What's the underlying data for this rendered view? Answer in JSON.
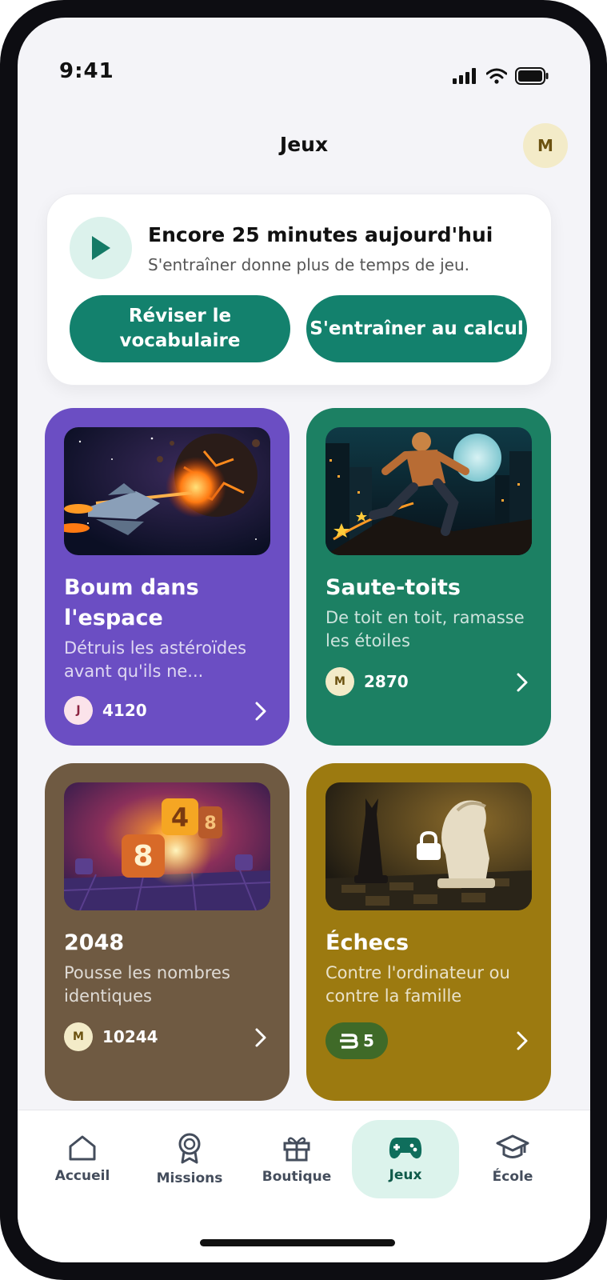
{
  "status": {
    "time": "9:41"
  },
  "header": {
    "title": "Jeux",
    "avatar_initial": "M"
  },
  "promo": {
    "title": "Encore 25 minutes aujourd'hui",
    "subtitle": "S'entraîner donne plus de temps de jeu.",
    "button_vocab": "Réviser le vocabulaire",
    "button_calc": "S'entraîner au calcul"
  },
  "games": [
    {
      "title": "Boum dans l'espace",
      "desc": "Détruis les astéroïdes avant qu'ils ne...",
      "player": "J",
      "score": "4120",
      "color": "#6b4ec3",
      "icon": "chevron-right-icon"
    },
    {
      "title": "Saute-toits",
      "desc": "De toit en toit, ramasse les étoiles",
      "player": "M",
      "score": "2870",
      "color": "#1c8063",
      "icon": "chevron-right-icon"
    },
    {
      "title": "2048",
      "desc": "Pousse les nombres identiques",
      "player": "M",
      "score": "10244",
      "color": "#6f5a42",
      "icon": "chevron-right-icon"
    },
    {
      "title": "Échecs",
      "desc": "Contre l'ordinateur ou contre la famille",
      "unlock_cost": "5",
      "color": "#9c7a10",
      "locked": true,
      "icon": "lock-icon"
    }
  ],
  "nav": {
    "items": [
      {
        "label": "Accueil",
        "icon": "home-icon"
      },
      {
        "label": "Missions",
        "icon": "medal-icon"
      },
      {
        "label": "Boutique",
        "icon": "gift-icon"
      },
      {
        "label": "Jeux",
        "icon": "gamepad-icon",
        "active": true
      },
      {
        "label": "École",
        "icon": "graduation-cap-icon"
      }
    ]
  },
  "colors": {
    "accent": "#13816d",
    "accent_soft": "#dcf3ec"
  }
}
